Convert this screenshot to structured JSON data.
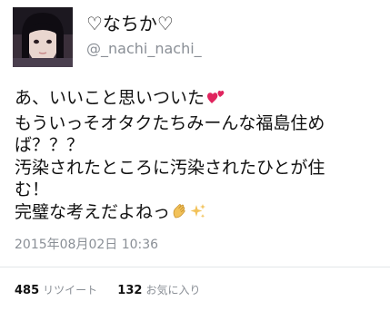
{
  "tweet": {
    "display_name": "♡なちか♡",
    "handle": "@_nachi_nachi_",
    "avatar_icon": "user-avatar-photo",
    "body_lines": [
      "あ、いいこと思いついた",
      "もういっそオタクたちみーんな福島住め",
      "ば？？？",
      "汚染されたところに汚染されたひとが住",
      "む！",
      "完璧な考えだよねっ"
    ],
    "emoji_line1": "two-hearts-emoji",
    "emoji_line6": "clapping-hands-sparkles-emoji",
    "timestamp": "2015年08月02日 10:36",
    "retweet_count": "485",
    "retweet_label": "リツイート",
    "like_count": "132",
    "like_label": "お気に入り",
    "colors": {
      "text": "#111111",
      "muted": "#8a8f96",
      "heart": "#e0245e",
      "sparkle": "#f2c25a",
      "divider": "#e3e6e8"
    }
  }
}
